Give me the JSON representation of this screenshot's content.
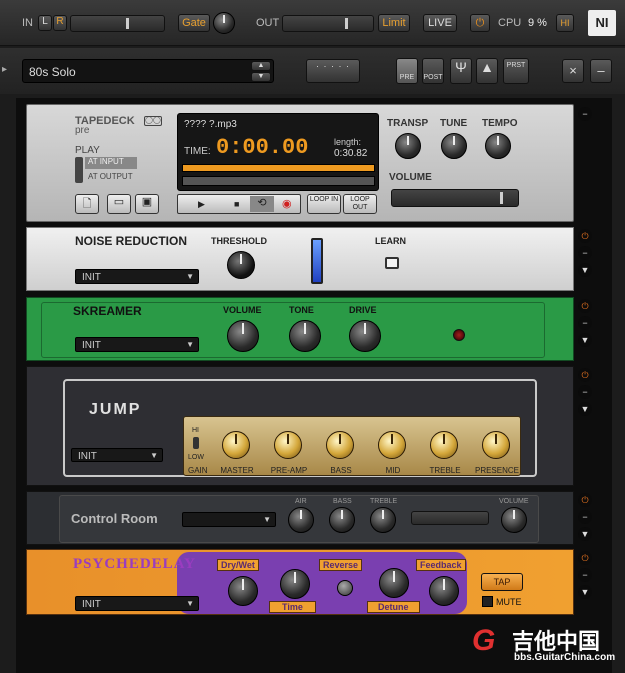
{
  "top": {
    "in_label": "IN",
    "l": "L",
    "r": "R",
    "gate": "Gate",
    "out_label": "OUT",
    "limit": "Limit",
    "live": "LIVE",
    "cpu_label": "CPU",
    "cpu_value": "9 %",
    "hi": "HI",
    "logo": "NI"
  },
  "preset": {
    "name": "80s Solo",
    "pre": "PRE",
    "post": "POST",
    "prst": "PRST"
  },
  "tapedeck": {
    "title": "TAPEDECK",
    "sub": "pre",
    "file": "???? ?.mp3",
    "time_label": "TIME:",
    "time": "0:00.00",
    "length_label": "length:",
    "length": "0:30.82",
    "play": "PLAY",
    "at_input": "AT INPUT",
    "at_output": "AT OUTPUT",
    "transp": "TRANSP",
    "tune": "TUNE",
    "tempo": "TEMPO",
    "volume": "VOLUME",
    "loop_in": "LOOP IN",
    "loop_out": "LOOP OUT"
  },
  "noise": {
    "title": "NOISE REDUCTION",
    "threshold": "THRESHOLD",
    "learn": "LEARN",
    "preset": "INIT"
  },
  "skreamer": {
    "title": "SKREAMER",
    "volume": "VOLUME",
    "tone": "TONE",
    "drive": "DRIVE",
    "preset": "INIT"
  },
  "jump": {
    "title": "JUMP",
    "preset": "INIT",
    "hi": "HI",
    "low": "LOW",
    "knobs": [
      "GAIN",
      "MASTER",
      "PRE-AMP",
      "BASS",
      "MID",
      "TREBLE",
      "PRESENCE"
    ]
  },
  "control": {
    "title": "Control Room",
    "air": "AIR",
    "bass": "BASS",
    "treble": "TREBLE",
    "volume": "VOLUME"
  },
  "psyche": {
    "title": "PSYCHEDELAY",
    "drywet": "Dry/Wet",
    "reverse": "Reverse",
    "feedback": "Feedback",
    "time": "Time",
    "detune": "Detune",
    "tap": "TAP",
    "mute": "MUTE",
    "preset": "INIT"
  },
  "watermark": {
    "cn": "吉他中国",
    "url": "bbs.GuitarChina.com"
  }
}
